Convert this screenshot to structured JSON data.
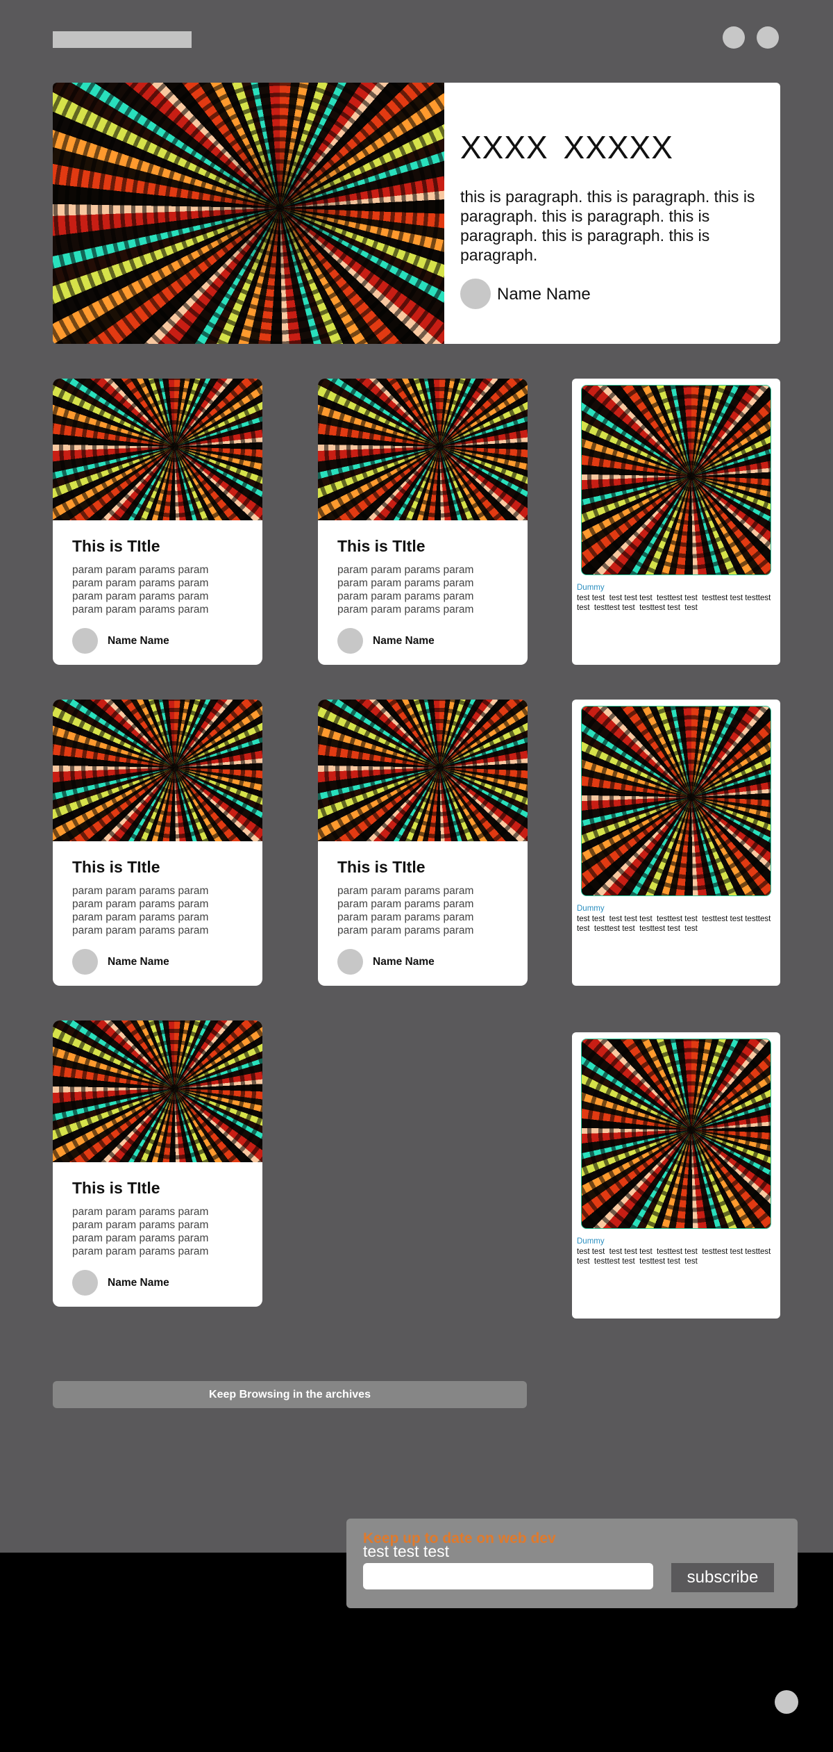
{
  "header": {
    "logo_icon": "logo-placeholder",
    "right_icons": [
      "circle-icon",
      "circle-icon"
    ]
  },
  "hero": {
    "title": "XXXX  XXXXX",
    "paragraph": "this is paragraph. this is paragraph. this is paragraph. this is paragraph. this is paragraph. this is paragraph. this is paragraph.",
    "author": "Name Name"
  },
  "cards": [
    {
      "title": "This is TItle",
      "body": "param param params param param param params param param param params param param param params param",
      "author": "Name Name"
    },
    {
      "title": "This is TItle",
      "body": "param param params param param param params param param param params param param param params param",
      "author": "Name Name"
    },
    {
      "title": "This is TItle",
      "body": "param param params param param param params param param param params param param param params param",
      "author": "Name Name"
    },
    {
      "title": "This is TItle",
      "body": "param param params param param param params param param param params param param param params param",
      "author": "Name Name"
    },
    {
      "title": "This is TItle",
      "body": "param param params param param param params param param param params param param param params param",
      "author": "Name Name"
    }
  ],
  "side_cards": [
    {
      "tag": "Dummy",
      "text": "test test  test test test  testtest test  testtest test testtest test  testtest test  testtest test  test"
    },
    {
      "tag": "Dummy",
      "text": "test test  test test test  testtest test  testtest test testtest test  testtest test  testtest test  test"
    },
    {
      "tag": "Dummy",
      "text": "test test  test test test  testtest test  testtest test testtest test  testtest test  testtest test  test"
    }
  ],
  "archive_button": "Keep Browsing in the archives",
  "newsletter": {
    "title": "Keep up to date on web dev",
    "subtitle": "test test test",
    "input_value": "",
    "button": "subscribe"
  },
  "colors": {
    "page_bg": "#5a595b",
    "footer_bg": "#000000",
    "accent_orange": "#e07a2c",
    "tag_blue": "#2b8fc0"
  }
}
